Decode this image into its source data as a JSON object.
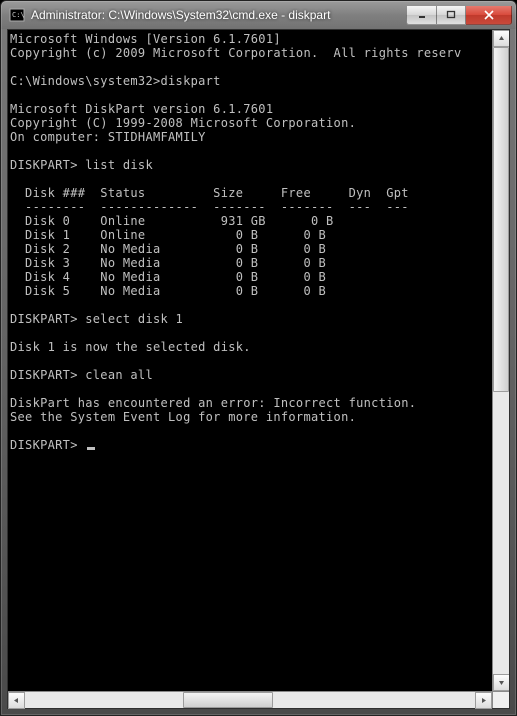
{
  "window": {
    "title": "Administrator: C:\\Windows\\System32\\cmd.exe - diskpart"
  },
  "terminal": {
    "lines": {
      "l0": "Microsoft Windows [Version 6.1.7601]",
      "l1": "Copyright (c) 2009 Microsoft Corporation.  All rights reserv",
      "l2": "",
      "l3": "C:\\Windows\\system32>diskpart",
      "l4": "",
      "l5": "Microsoft DiskPart version 6.1.7601",
      "l6": "Copyright (C) 1999-2008 Microsoft Corporation.",
      "l7": "On computer: STIDHAMFAMILY",
      "l8": "",
      "l9": "DISKPART> list disk",
      "l10": "",
      "l11": "  Disk ###  Status         Size     Free     Dyn  Gpt",
      "l12": "  --------  -------------  -------  -------  ---  ---",
      "l13": "  Disk 0    Online          931 GB      0 B",
      "l14": "  Disk 1    Online            0 B      0 B",
      "l15": "  Disk 2    No Media          0 B      0 B",
      "l16": "  Disk 3    No Media          0 B      0 B",
      "l17": "  Disk 4    No Media          0 B      0 B",
      "l18": "  Disk 5    No Media          0 B      0 B",
      "l19": "",
      "l20": "DISKPART> select disk 1",
      "l21": "",
      "l22": "Disk 1 is now the selected disk.",
      "l23": "",
      "l24": "DISKPART> clean all",
      "l25": "",
      "l26": "DiskPart has encountered an error: Incorrect function.",
      "l27": "See the System Event Log for more information.",
      "l28": "",
      "l29": "DISKPART> "
    },
    "disk_table": {
      "headers": [
        "Disk ###",
        "Status",
        "Size",
        "Free",
        "Dyn",
        "Gpt"
      ],
      "rows": [
        {
          "disk": "Disk 0",
          "status": "Online",
          "size": "931 GB",
          "free": "0 B",
          "dyn": "",
          "gpt": ""
        },
        {
          "disk": "Disk 1",
          "status": "Online",
          "size": "0 B",
          "free": "0 B",
          "dyn": "",
          "gpt": ""
        },
        {
          "disk": "Disk 2",
          "status": "No Media",
          "size": "0 B",
          "free": "0 B",
          "dyn": "",
          "gpt": ""
        },
        {
          "disk": "Disk 3",
          "status": "No Media",
          "size": "0 B",
          "free": "0 B",
          "dyn": "",
          "gpt": ""
        },
        {
          "disk": "Disk 4",
          "status": "No Media",
          "size": "0 B",
          "free": "0 B",
          "dyn": "",
          "gpt": ""
        },
        {
          "disk": "Disk 5",
          "status": "No Media",
          "size": "0 B",
          "free": "0 B",
          "dyn": "",
          "gpt": ""
        }
      ]
    }
  }
}
